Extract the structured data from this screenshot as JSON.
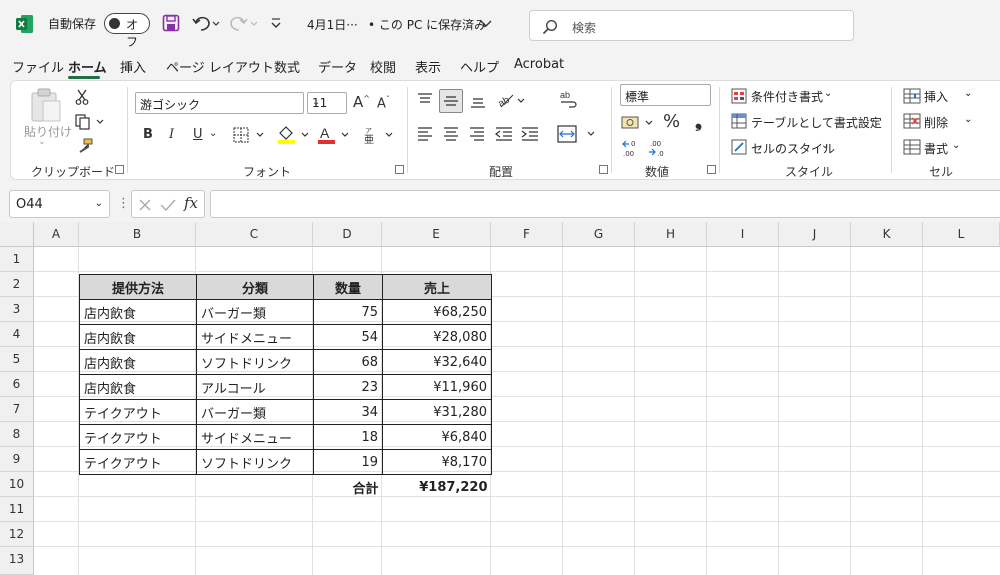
{
  "titlebar": {
    "autosave_label": "自動保存",
    "autosave_state": "オフ",
    "doc_title": "4月1日···",
    "save_state": "• この PC に保存済み",
    "search_placeholder": "検索"
  },
  "tabs": [
    "ファイル",
    "ホーム",
    "挿入",
    "ページ レイアウト",
    "数式",
    "データ",
    "校閲",
    "表示",
    "ヘルプ",
    "Acrobat"
  ],
  "active_tab": "ホーム",
  "ribbon": {
    "clipboard": {
      "paste": "貼り付け",
      "label": "クリップボード"
    },
    "font": {
      "name": "游ゴシック",
      "size": "11",
      "label": "フォント"
    },
    "alignment": {
      "label": "配置"
    },
    "number": {
      "format": "標準",
      "label": "数値"
    },
    "styles": {
      "conditional": "条件付き書式",
      "as_table": "テーブルとして書式設定",
      "cell_styles": "セルのスタイル",
      "label": "スタイル"
    },
    "cells": {
      "insert": "挿入",
      "delete": "削除",
      "format": "書式",
      "label": "セル"
    }
  },
  "formula_bar": {
    "name_box": "O44",
    "formula": ""
  },
  "columns": [
    "A",
    "B",
    "C",
    "D",
    "E",
    "F",
    "G",
    "H",
    "I",
    "J",
    "K",
    "L"
  ],
  "rows": [
    "1",
    "2",
    "3",
    "4",
    "5",
    "6",
    "7",
    "8",
    "9",
    "10",
    "11",
    "12",
    "13"
  ],
  "table": {
    "headers": [
      "提供方法",
      "分類",
      "数量",
      "売上"
    ],
    "rows": [
      [
        "店内飲食",
        "バーガー類",
        "75",
        "¥68,250"
      ],
      [
        "店内飲食",
        "サイドメニュー",
        "54",
        "¥28,080"
      ],
      [
        "店内飲食",
        "ソフトドリンク",
        "68",
        "¥32,640"
      ],
      [
        "店内飲食",
        "アルコール",
        "23",
        "¥11,960"
      ],
      [
        "テイクアウト",
        "バーガー類",
        "34",
        "¥31,280"
      ],
      [
        "テイクアウト",
        "サイドメニュー",
        "18",
        "¥6,840"
      ],
      [
        "テイクアウト",
        "ソフトドリンク",
        "19",
        "¥8,170"
      ]
    ],
    "total_label": "合計",
    "total_value": "¥187,220"
  },
  "colors": {
    "excel_green": "#1e7145",
    "header_fill": "#d9d9d9"
  }
}
